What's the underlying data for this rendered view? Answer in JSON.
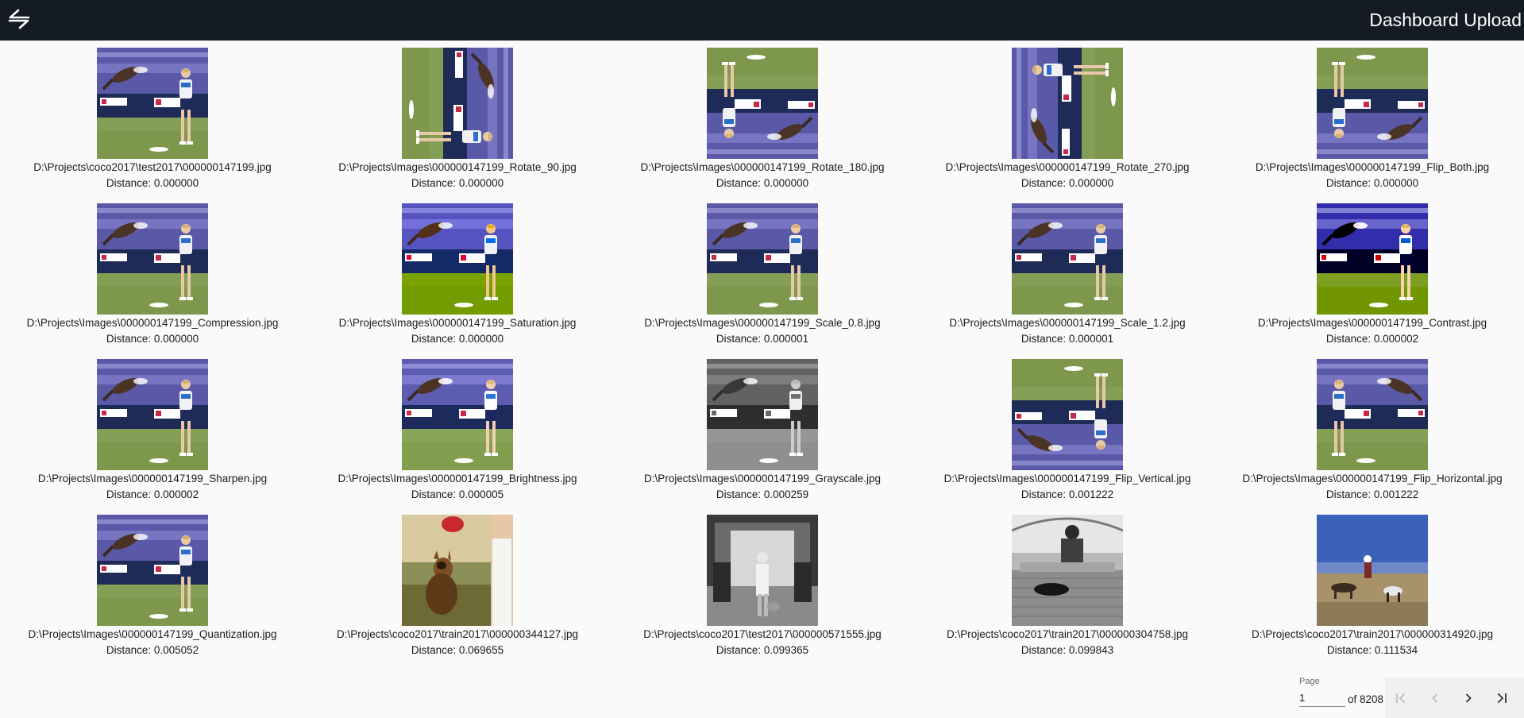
{
  "header": {
    "upload_label": "Dashboard Upload",
    "logo_icon": "swap-arrows-logo-icon",
    "background": "#141b24"
  },
  "results": [
    {
      "path": "D:\\Projects\\coco2017\\test2017\\000000147199.jpg",
      "distance": "Distance: 0.000000",
      "variant": "original"
    },
    {
      "path": "D:\\Projects\\Images\\000000147199_Rotate_90.jpg",
      "distance": "Distance: 0.000000",
      "variant": "rotate90"
    },
    {
      "path": "D:\\Projects\\Images\\000000147199_Rotate_180.jpg",
      "distance": "Distance: 0.000000",
      "variant": "rotate180"
    },
    {
      "path": "D:\\Projects\\Images\\000000147199_Rotate_270.jpg",
      "distance": "Distance: 0.000000",
      "variant": "rotate270"
    },
    {
      "path": "D:\\Projects\\Images\\000000147199_Flip_Both.jpg",
      "distance": "Distance: 0.000000",
      "variant": "flipboth"
    },
    {
      "path": "D:\\Projects\\Images\\000000147199_Compression.jpg",
      "distance": "Distance: 0.000000",
      "variant": "original"
    },
    {
      "path": "D:\\Projects\\Images\\000000147199_Saturation.jpg",
      "distance": "Distance: 0.000000",
      "variant": "saturated"
    },
    {
      "path": "D:\\Projects\\Images\\000000147199_Scale_0.8.jpg",
      "distance": "Distance: 0.000001",
      "variant": "original"
    },
    {
      "path": "D:\\Projects\\Images\\000000147199_Scale_1.2.jpg",
      "distance": "Distance: 0.000001",
      "variant": "original"
    },
    {
      "path": "D:\\Projects\\Images\\000000147199_Contrast.jpg",
      "distance": "Distance: 0.000002",
      "variant": "contrast"
    },
    {
      "path": "D:\\Projects\\Images\\000000147199_Sharpen.jpg",
      "distance": "Distance: 0.000002",
      "variant": "original"
    },
    {
      "path": "D:\\Projects\\Images\\000000147199_Brightness.jpg",
      "distance": "Distance: 0.000005",
      "variant": "bright"
    },
    {
      "path": "D:\\Projects\\Images\\000000147199_Grayscale.jpg",
      "distance": "Distance: 0.000259",
      "variant": "gray"
    },
    {
      "path": "D:\\Projects\\Images\\000000147199_Flip_Vertical.jpg",
      "distance": "Distance: 0.001222",
      "variant": "flipv"
    },
    {
      "path": "D:\\Projects\\Images\\000000147199_Flip_Horizontal.jpg",
      "distance": "Distance: 0.001222",
      "variant": "fliph"
    },
    {
      "path": "D:\\Projects\\Images\\000000147199_Quantization.jpg",
      "distance": "Distance: 0.005052",
      "variant": "original"
    },
    {
      "path": "D:\\Projects\\coco2017\\train2017\\000000344127.jpg",
      "distance": "Distance: 0.069655",
      "variant": "dog-frisbee"
    },
    {
      "path": "D:\\Projects\\coco2017\\test2017\\000000571555.jpg",
      "distance": "Distance: 0.099365",
      "variant": "train-bw"
    },
    {
      "path": "D:\\Projects\\coco2017\\train2017\\000000304758.jpg",
      "distance": "Distance: 0.099843",
      "variant": "bench-bw"
    },
    {
      "path": "D:\\Projects\\coco2017\\train2017\\000000314920.jpg",
      "distance": "Distance: 0.111534",
      "variant": "beach-dogs"
    }
  ],
  "paginator": {
    "label": "Page",
    "current_page": "1",
    "of_text": "of 8208",
    "first_icon": "first-page-icon",
    "prev_icon": "chevron-left-icon",
    "next_icon": "chevron-right-icon",
    "last_icon": "last-page-icon"
  }
}
